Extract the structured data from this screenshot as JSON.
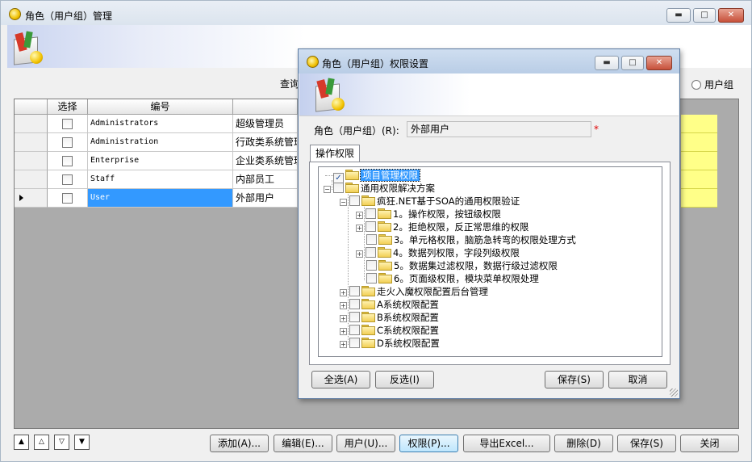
{
  "main_window": {
    "title": "角色（用户组）管理",
    "controls": {
      "minimize": "▬",
      "maximize": "□",
      "close": "✕"
    }
  },
  "filter": {
    "query_label": "查询",
    "radio_label": "用户组"
  },
  "grid": {
    "columns": [
      "选择",
      "编号"
    ],
    "rows": [
      {
        "code": "Administrators",
        "name": "超级管理员",
        "checked": false,
        "selected": false
      },
      {
        "code": "Administration",
        "name": "行政类系统管理",
        "checked": false,
        "selected": false
      },
      {
        "code": "Enterprise",
        "name": "企业类系统管理",
        "checked": false,
        "selected": false
      },
      {
        "code": "Staff",
        "name": "内部员工",
        "checked": false,
        "selected": false
      },
      {
        "code": "User",
        "name": "外部用户",
        "checked": false,
        "selected": true
      }
    ],
    "selection_color": "#3399ff",
    "highlight_color": "#ffff88"
  },
  "nav_buttons": [
    "▲",
    "△",
    "▽",
    "▼"
  ],
  "toolbar": {
    "add": "添加(A)...",
    "edit": "编辑(E)...",
    "users": "用户(U)...",
    "permissions": "权限(P)...",
    "export": "导出Excel...",
    "delete": "删除(D)",
    "save": "保存(S)",
    "close": "关闭"
  },
  "dialog": {
    "title": "角色（用户组）权限设置",
    "role_label": "角色（用户组）(R):",
    "role_value": "外部用户",
    "required_mark": "*",
    "tab_label": "操作权限",
    "tree": {
      "root1": {
        "label": "项目管理权限",
        "checked": true
      },
      "root2": {
        "label": "通用权限解决方案",
        "checked": false
      },
      "child1": {
        "label": "疯狂.NET基于SOA的通用权限验证"
      },
      "leaves": [
        "1。操作权限，按钮级权限",
        "2。拒绝权限，反正常思维的权限",
        "3。单元格权限，脑筋急转弯的权限处理方式",
        "4。数据列权限，字段列级权限",
        "5。数据集过滤权限，数据行级过滤权限",
        "6。页面级权限，模块菜单权限处理"
      ],
      "siblings": [
        "走火入魔权限配置后台管理",
        "A系统权限配置",
        "B系统权限配置",
        "C系统权限配置",
        "D系统权限配置"
      ]
    },
    "buttons": {
      "select_all": "全选(A)",
      "invert": "反选(I)",
      "save": "保存(S)",
      "cancel": "取消"
    }
  }
}
